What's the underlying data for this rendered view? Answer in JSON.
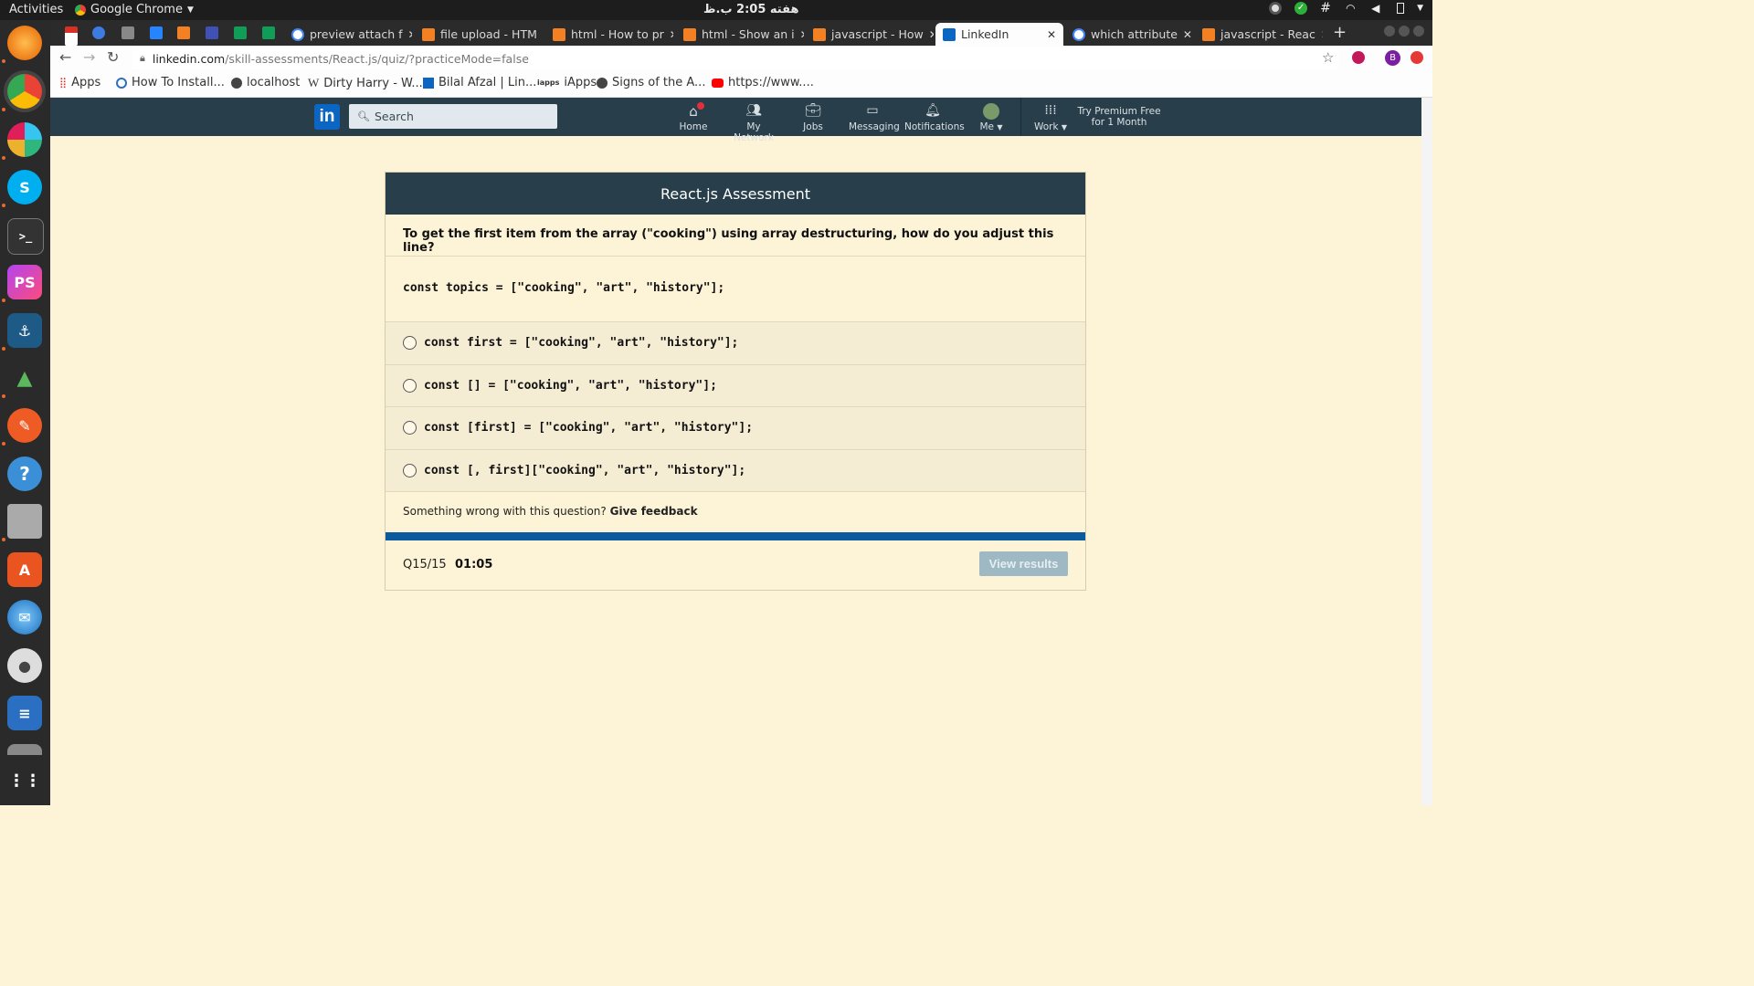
{
  "system": {
    "activities": "Activities",
    "app_name": "Google Chrome",
    "clock": "هفته 2:05 ب.ظ"
  },
  "tabs": [
    {
      "title": "preview attach f"
    },
    {
      "title": "file upload - HTM"
    },
    {
      "title": "html - How to pr"
    },
    {
      "title": "html - Show an i"
    },
    {
      "title": "javascript - How"
    },
    {
      "title": "LinkedIn",
      "active": true
    },
    {
      "title": "which attribute"
    },
    {
      "title": "javascript - Reac"
    }
  ],
  "browser": {
    "url_host": "linkedin.com",
    "url_path": "/skill-assessments/React.js/quiz/?practiceMode=false",
    "profile_initial": "B"
  },
  "bookmarks": [
    {
      "label": "Apps"
    },
    {
      "label": "How To Install..."
    },
    {
      "label": "localhost"
    },
    {
      "label": "Dirty Harry - W..."
    },
    {
      "label": "Bilal Afzal | Lin..."
    },
    {
      "label": "iApps"
    },
    {
      "label": "Signs of the A..."
    },
    {
      "label": "https://www...."
    }
  ],
  "linkedin": {
    "search_placeholder": "Search",
    "nav": {
      "home": "Home",
      "network": "My Network",
      "jobs": "Jobs",
      "messaging": "Messaging",
      "notifications": "Notifications",
      "me": "Me",
      "work": "Work"
    },
    "premium_line1": "Try Premium Free",
    "premium_line2": "for 1 Month"
  },
  "quiz": {
    "title": "React.js Assessment",
    "question": "To get the first item from the array (\"cooking\") using array destructuring, how do you adjust this line?",
    "code": "const topics = [\"cooking\", \"art\", \"history\"];",
    "options": [
      "const first = [\"cooking\", \"art\", \"history\"];",
      "const [] = [\"cooking\", \"art\", \"history\"];",
      "const [first] = [\"cooking\", \"art\", \"history\"];",
      "const [, first][\"cooking\", \"art\", \"history\"];"
    ],
    "feedback_prefix": "Something wrong with this question?",
    "feedback_link": "Give feedback",
    "progress": "Q15/15",
    "timer": "01:05",
    "view_results": "View results"
  }
}
